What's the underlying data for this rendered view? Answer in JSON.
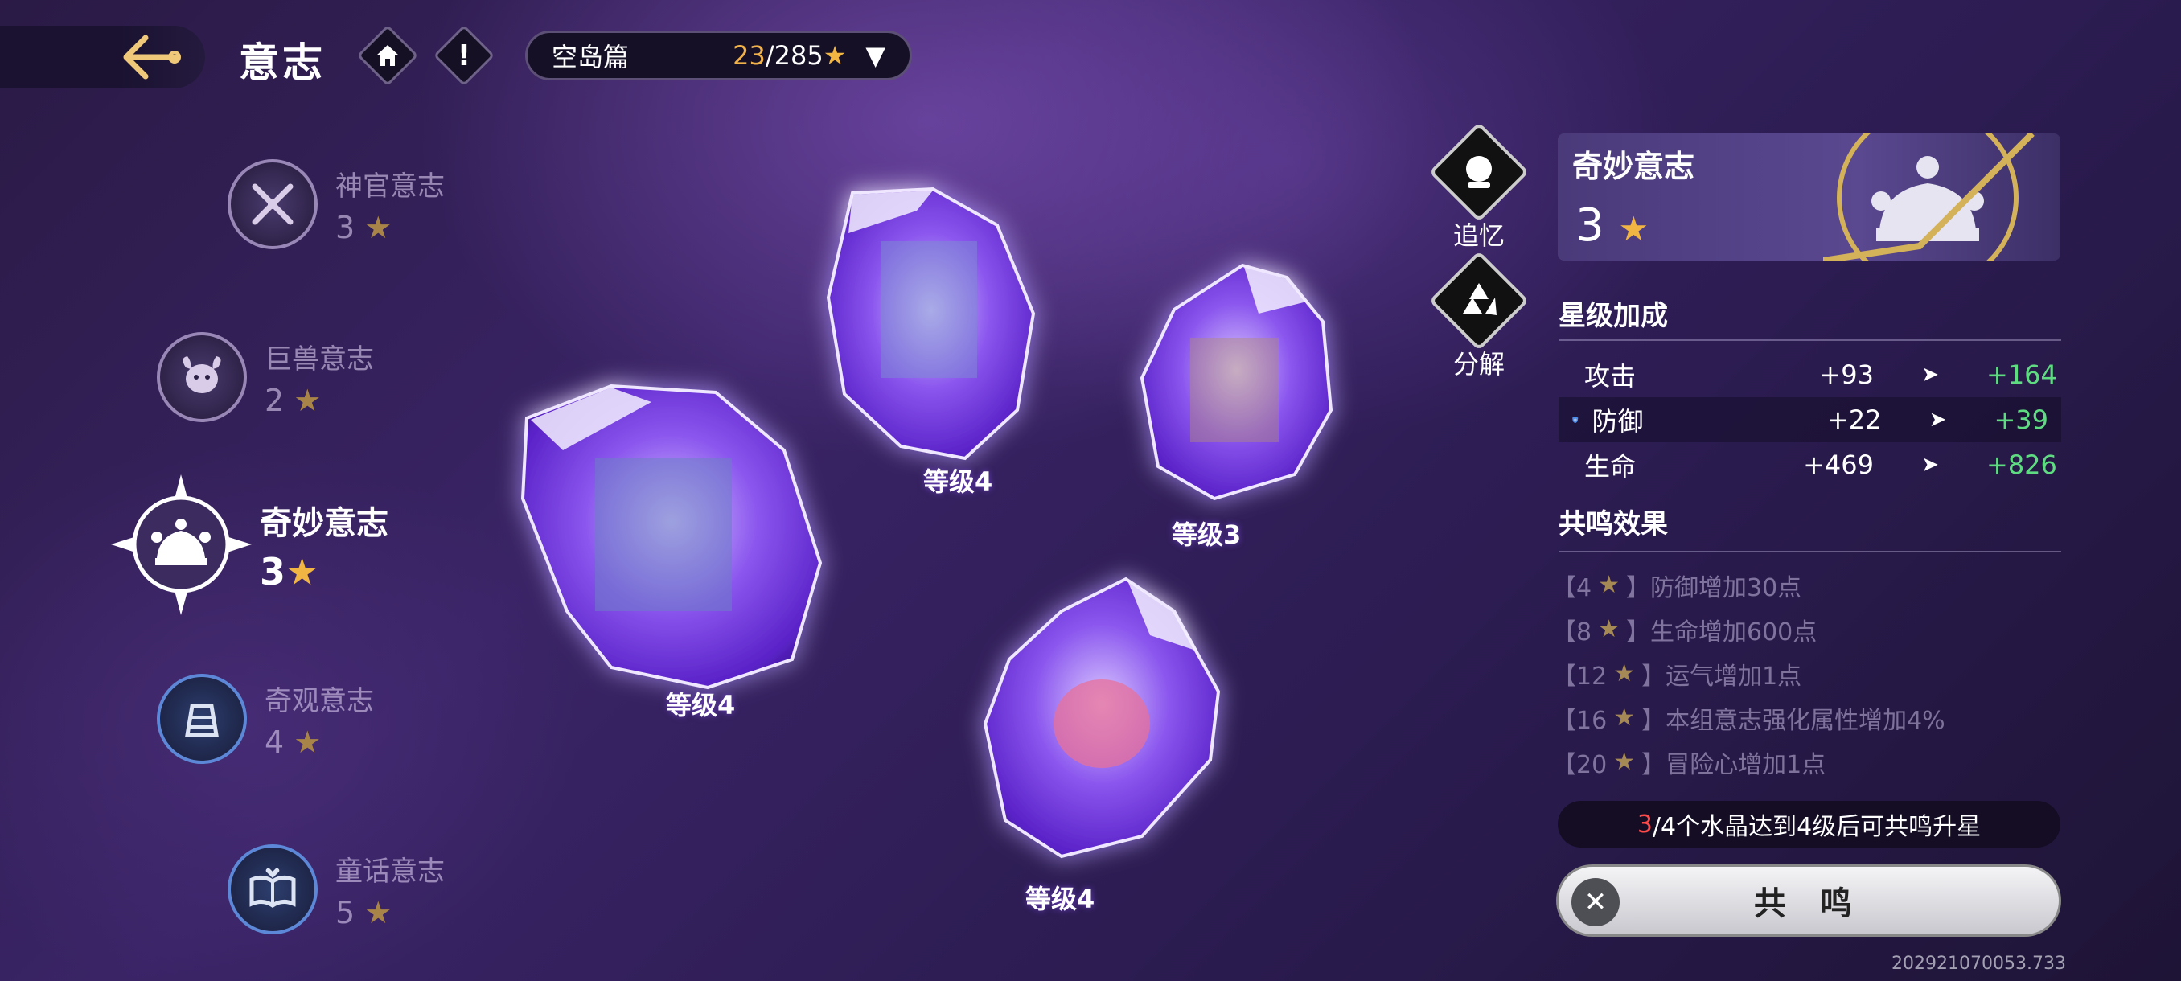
{
  "header": {
    "title": "意志",
    "arc_selector": {
      "name": "空岛篇",
      "progress_current": "23",
      "progress_total": "/285",
      "star": "★",
      "dropdown": "▼"
    }
  },
  "will_list": [
    {
      "name": "神官意志",
      "stars": "3",
      "star": "★",
      "active": false
    },
    {
      "name": "巨兽意志",
      "stars": "2",
      "star": "★",
      "active": false
    },
    {
      "name": "奇妙意志",
      "stars": "3",
      "star": "★",
      "active": true
    },
    {
      "name": "奇观意志",
      "stars": "4",
      "star": "★",
      "active": false
    },
    {
      "name": "童话意志",
      "stars": "5",
      "star": "★",
      "active": false
    }
  ],
  "crystals": [
    {
      "label": "等级4"
    },
    {
      "label": "等级4"
    },
    {
      "label": "等级3"
    },
    {
      "label": "等级4"
    }
  ],
  "side_buttons": {
    "recall": "追忆",
    "decompose": "分解"
  },
  "detail": {
    "name": "奇妙意志",
    "stars": "3",
    "star": "★",
    "star_bonus_title": "星级加成",
    "stats": [
      {
        "name": "攻击",
        "current": "+93",
        "arrow": "➤",
        "next": "+164",
        "color": "#e0503c"
      },
      {
        "name": "防御",
        "current": "+22",
        "arrow": "➤",
        "next": "+39",
        "color": "#4a8ef0"
      },
      {
        "name": "生命",
        "current": "+469",
        "arrow": "➤",
        "next": "+826",
        "color": "#3ad67a"
      }
    ],
    "resonance_title": "共鸣效果",
    "resonance": [
      {
        "open": "【4",
        "star": "★",
        "close": "】",
        "text": "防御增加30点"
      },
      {
        "open": "【8",
        "star": "★",
        "close": "】",
        "text": "生命增加600点"
      },
      {
        "open": "【12",
        "star": "★",
        "close": "】",
        "text": "运气增加1点"
      },
      {
        "open": "【16",
        "star": "★",
        "close": "】",
        "text": "本组意志强化属性增加4%"
      },
      {
        "open": "【20",
        "star": "★",
        "close": "】",
        "text": "冒险心增加1点"
      }
    ],
    "hint_count": "3",
    "hint_text": "/4个水晶达到4级后可共鸣升星",
    "resonate_label": "共 鸣",
    "close_symbol": "✕"
  },
  "build_id": "202921070053.733"
}
